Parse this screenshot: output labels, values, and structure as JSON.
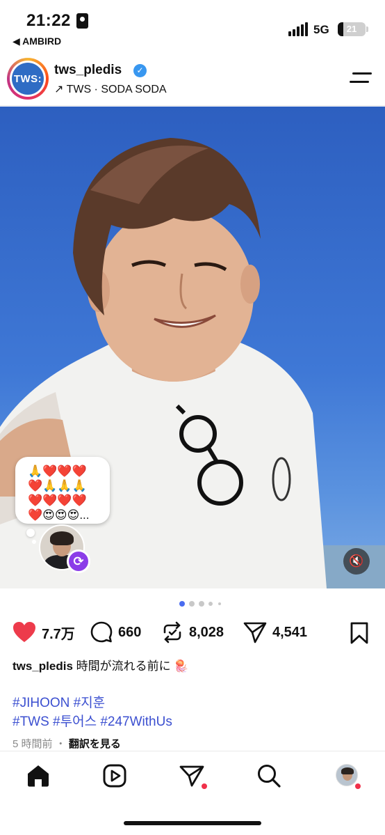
{
  "status_bar": {
    "time": "21:22",
    "back_app": "◀ AMBIRD",
    "network": "5G",
    "battery_percent": "21"
  },
  "header": {
    "avatar_text": "TWS:",
    "username": "tws_pledis",
    "verified_mark": "✓",
    "music": "↗ TWS · SODA SODA"
  },
  "post": {
    "note": {
      "lines": [
        "🙏❤️❤️❤️",
        "❤️🙏🙏🙏",
        "❤️❤️❤️❤️",
        "❤️😍😍😍..."
      ]
    },
    "carousel": {
      "count": 5,
      "active_index": 0
    },
    "mute_icon": "🔇",
    "repost_badge_icon": "⟳"
  },
  "actions": {
    "likes": "7.7万",
    "comments": "660",
    "reposts": "8,028",
    "shares": "4,541"
  },
  "caption": {
    "username": "tws_pledis",
    "text": "時間が流れる前に 🪼"
  },
  "hashtags": {
    "line1": "#JIHOON #지훈",
    "line2": "#TWS #투어스 #247WithUs"
  },
  "meta": {
    "time_ago": "5 時間前",
    "separator": "・",
    "translate": "翻訳を見る"
  },
  "colors": {
    "like_red": "#ed3b4b",
    "hashtag_blue": "#3b4fd0",
    "sky": "#3f78d6",
    "notification_dot": "#f0304a"
  },
  "icons": {
    "home": "home-icon",
    "reels": "reels-icon",
    "send": "send-icon",
    "search": "search-icon",
    "profile": "profile-avatar"
  }
}
